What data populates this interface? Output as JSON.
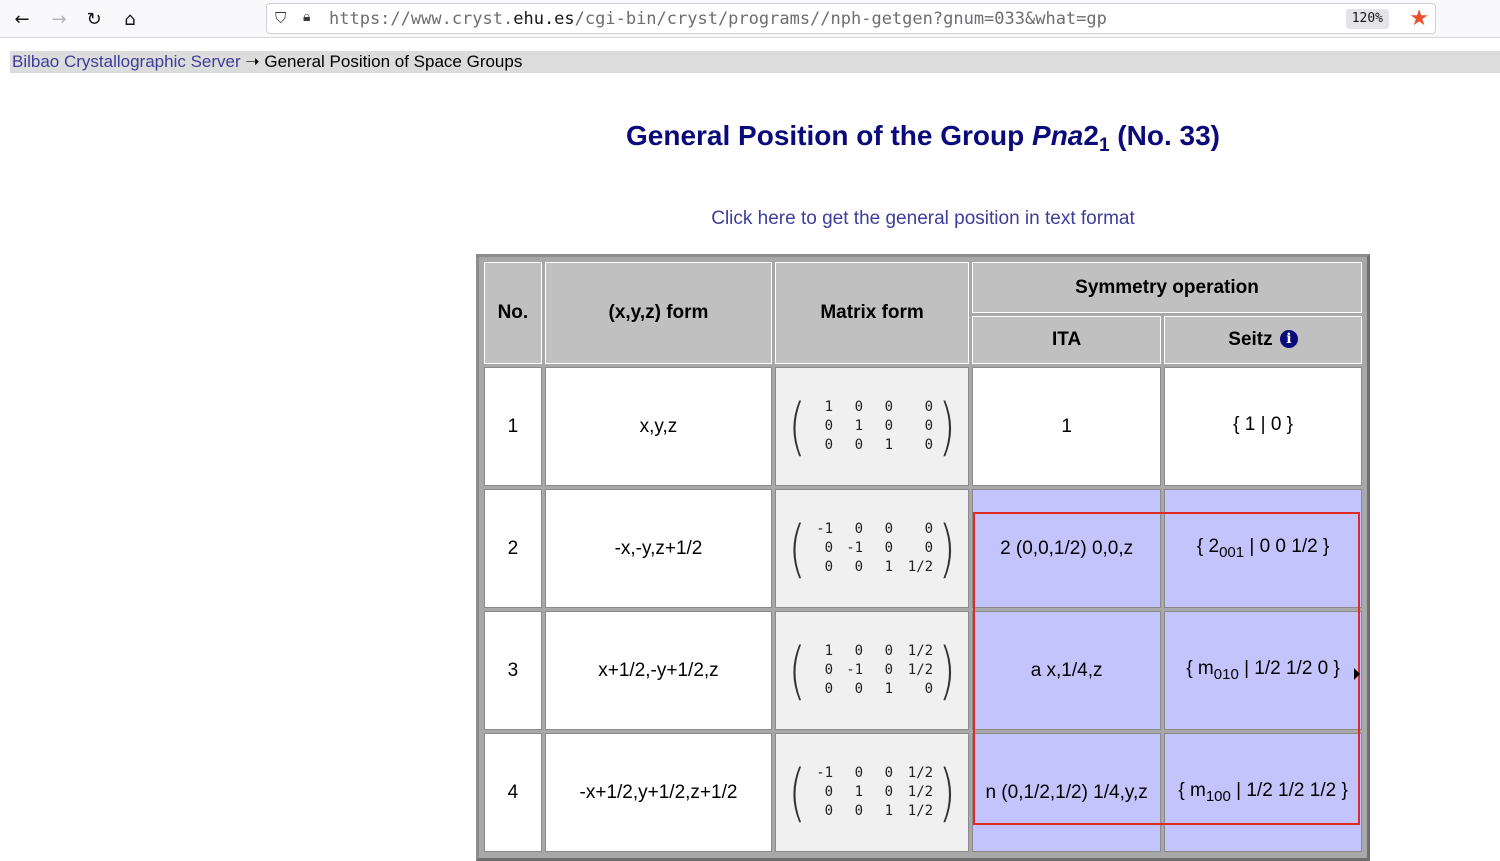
{
  "browser": {
    "url_prefix": "https://www.cryst.",
    "url_domain": "ehu.es",
    "url_path": "/cgi-bin/cryst/programs//nph-getgen?gnum=033&what=gp",
    "zoom": "120%"
  },
  "breadcrumb": {
    "home_link": "Bilbao Crystallographic Server",
    "arrow": " ➝ ",
    "current": "General Position of Space Groups"
  },
  "title": {
    "prefix": "General Position of the Group ",
    "group_italic": "Pna",
    "group_digit": "2",
    "group_sub": "1",
    "suffix": " (No. 33)"
  },
  "text_format_link": "Click here to get the general position in text format",
  "table": {
    "headers": {
      "no": "No.",
      "xyz": "(x,y,z) form",
      "matrix": "Matrix form",
      "symop": "Symmetry operation",
      "ita": "ITA",
      "seitz": "Seitz"
    },
    "rows": [
      {
        "no": "1",
        "xyz": "x,y,z",
        "matrix": [
          [
            "1",
            "0",
            "0",
            "0"
          ],
          [
            "0",
            "1",
            "0",
            "0"
          ],
          [
            "0",
            "0",
            "1",
            "0"
          ]
        ],
        "ita": "1",
        "seitz_pre": "{ 1 | 0 }",
        "seitz_sub": "",
        "seitz_post": ""
      },
      {
        "no": "2",
        "xyz": "-x,-y,z+1/2",
        "matrix": [
          [
            "-1",
            "0",
            "0",
            "0"
          ],
          [
            "0",
            "-1",
            "0",
            "0"
          ],
          [
            "0",
            "0",
            "1",
            "1/2"
          ]
        ],
        "ita": "2 (0,0,1/2) 0,0,z",
        "seitz_pre": "{ 2",
        "seitz_sub": "001",
        "seitz_post": " | 0 0 1/2 }"
      },
      {
        "no": "3",
        "xyz": "x+1/2,-y+1/2,z",
        "matrix": [
          [
            "1",
            "0",
            "0",
            "1/2"
          ],
          [
            "0",
            "-1",
            "0",
            "1/2"
          ],
          [
            "0",
            "0",
            "1",
            "0"
          ]
        ],
        "ita": "a x,1/4,z",
        "seitz_pre": "{ m",
        "seitz_sub": "010",
        "seitz_post": " | 1/2 1/2 0 }"
      },
      {
        "no": "4",
        "xyz": "-x+1/2,y+1/2,z+1/2",
        "matrix": [
          [
            "-1",
            "0",
            "0",
            "1/2"
          ],
          [
            "0",
            "1",
            "0",
            "1/2"
          ],
          [
            "0",
            "0",
            "1",
            "1/2"
          ]
        ],
        "ita": "n (0,1/2,1/2) 1/4,y,z",
        "seitz_pre": "{ m",
        "seitz_sub": "100",
        "seitz_post": " | 1/2 1/2 1/2 }"
      }
    ]
  },
  "colors": {
    "highlight": "#c4c4fc",
    "annotation_box": "#e02a2a",
    "title": "#0a0a7a",
    "link": "#3d3d9b"
  }
}
